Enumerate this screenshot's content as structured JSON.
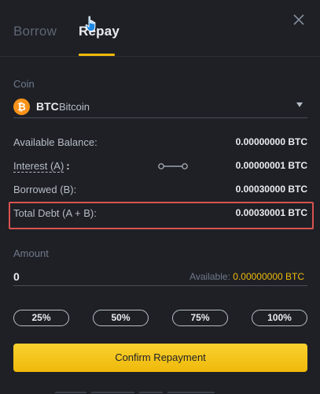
{
  "tabs": {
    "borrow": "Borrow",
    "repay": "Repay"
  },
  "coin": {
    "label": "Coin",
    "symbol": "BTC",
    "name": "Bitcoin",
    "logo_glyph": "₿"
  },
  "rows": {
    "available_balance": {
      "label": "Available Balance:",
      "value": "0.00000000 BTC"
    },
    "interest": {
      "label": "Interest (A)",
      "colon": ":",
      "value": "0.00000001 BTC"
    },
    "borrowed": {
      "label": "Borrowed (B):",
      "value": "0.00030000 BTC"
    },
    "total_debt": {
      "label": "Total Debt (A + B):",
      "value": "0.00030001 BTC"
    }
  },
  "amount": {
    "label": "Amount",
    "value": "0",
    "available_label": "Available:",
    "available_value": "0.00000000 BTC"
  },
  "percent_buttons": [
    "25%",
    "50%",
    "75%",
    "100%"
  ],
  "confirm_label": "Confirm Repayment",
  "colors": {
    "accent": "#f0b90b",
    "background": "#1e2026",
    "highlight": "#d9534f"
  }
}
